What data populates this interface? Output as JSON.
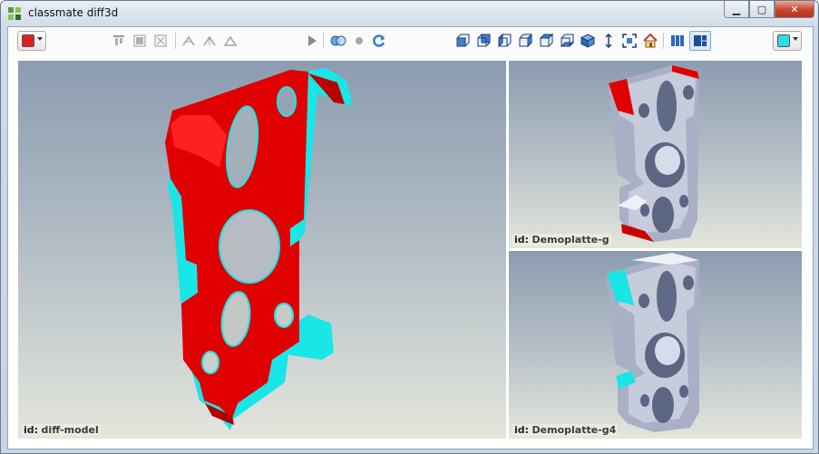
{
  "window": {
    "title": "classmate diff3d",
    "controls": {
      "minimize": "minimize-icon",
      "maximize": "maximize-icon",
      "close": "close-icon"
    }
  },
  "toolbar": {
    "left_color": "#e02020",
    "right_color": "#30d8e8",
    "groups": [
      {
        "name": "align",
        "icons": [
          "align-top-icon",
          "align-middle-icon",
          "align-bottom-icon"
        ]
      },
      {
        "name": "transform",
        "icons": [
          "rotate-x-icon",
          "rotate-y-icon",
          "rotate-z-icon"
        ]
      },
      {
        "name": "playback",
        "icons": [
          "play-icon"
        ]
      },
      {
        "name": "compare",
        "icons": [
          "overlap-icon",
          "dot-icon",
          "refresh-icon"
        ]
      },
      {
        "name": "views",
        "icons": [
          "view-front-icon",
          "view-back-icon",
          "view-left-icon",
          "view-right-icon",
          "view-top-icon",
          "view-bottom-icon",
          "view-iso-icon",
          "axis-icon",
          "fit-icon",
          "home-icon"
        ]
      },
      {
        "name": "layout",
        "icons": [
          "layout-columns-icon",
          "layout-split-icon"
        ]
      }
    ]
  },
  "viewports": {
    "main": {
      "id_key": "id:",
      "id_value": "diff-model"
    },
    "top_right": {
      "id_key": "id:",
      "id_value": "Demoplatte-g"
    },
    "bottom_right": {
      "id_key": "id:",
      "id_value": "Demoplatte-g4"
    }
  },
  "colors": {
    "diff_red": "#e00000",
    "diff_cyan": "#19e6e6",
    "model_gray": "#b6bcd0"
  }
}
